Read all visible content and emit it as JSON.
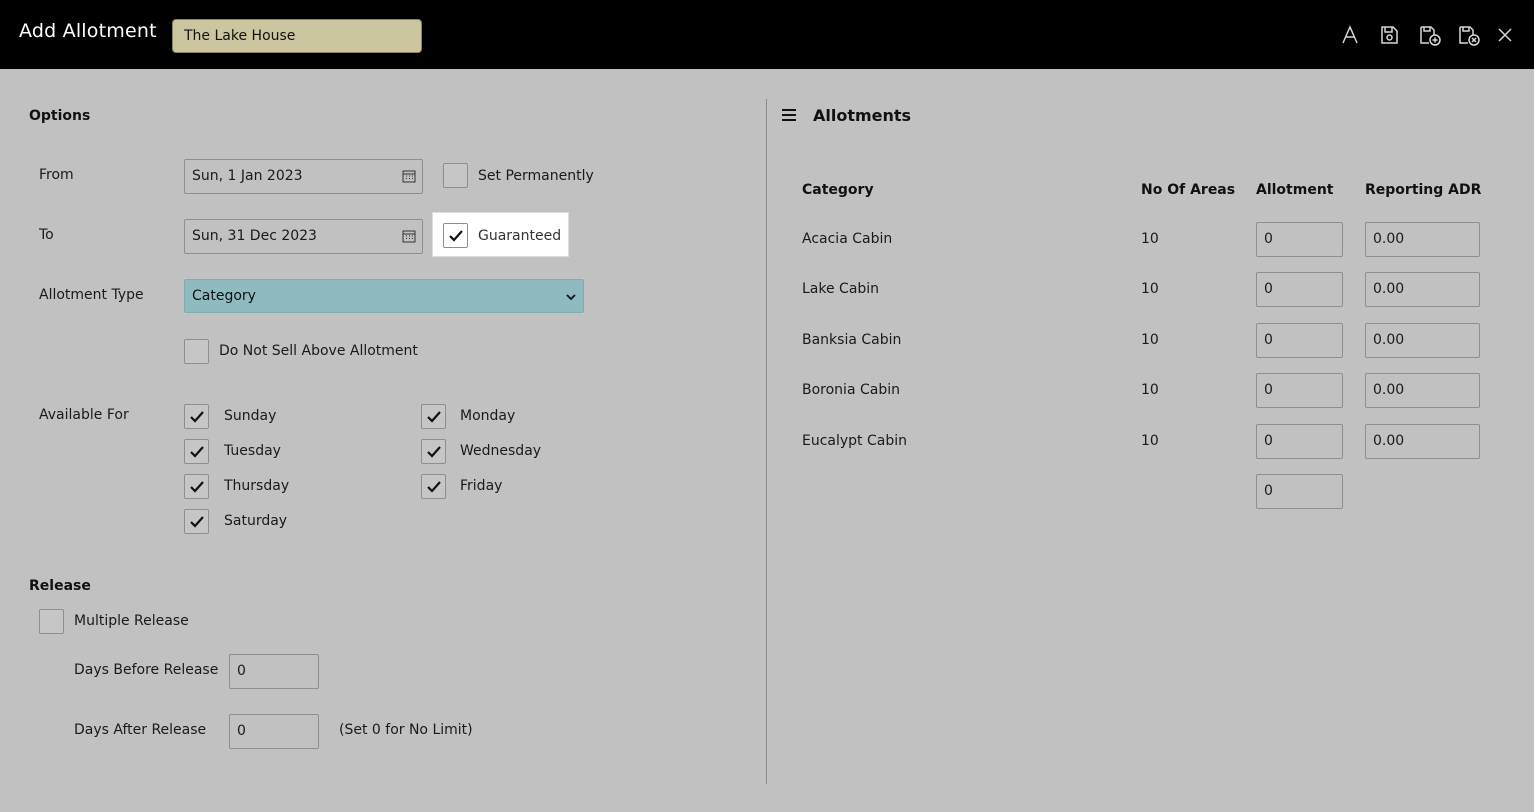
{
  "header": {
    "title": "Add Allotment",
    "property": "The Lake House",
    "icons": [
      "text-icon",
      "save-icon",
      "save-new-icon",
      "save-close-icon",
      "close-icon"
    ]
  },
  "options": {
    "heading": "Options",
    "from_label": "From",
    "from_value": "Sun, 1 Jan 2023",
    "to_label": "To",
    "to_value": "Sun, 31 Dec 2023",
    "set_permanently_label": "Set Permanently",
    "set_permanently_checked": false,
    "guaranteed_label": "Guaranteed",
    "guaranteed_checked": true,
    "allotment_type_label": "Allotment Type",
    "allotment_type_value": "Category",
    "do_not_sell_label": "Do Not Sell Above Allotment",
    "do_not_sell_checked": false,
    "available_for_label": "Available For",
    "days": [
      {
        "label": "Sunday",
        "checked": true
      },
      {
        "label": "Monday",
        "checked": true
      },
      {
        "label": "Tuesday",
        "checked": true
      },
      {
        "label": "Wednesday",
        "checked": true
      },
      {
        "label": "Thursday",
        "checked": true
      },
      {
        "label": "Friday",
        "checked": true
      },
      {
        "label": "Saturday",
        "checked": true
      }
    ]
  },
  "release": {
    "heading": "Release",
    "multiple_release_label": "Multiple Release",
    "multiple_release_checked": false,
    "days_before_label": "Days Before Release",
    "days_before_value": "0",
    "days_after_label": "Days After Release",
    "days_after_value": "0",
    "note": "(Set 0 for No Limit)"
  },
  "allotments": {
    "heading": "Allotments",
    "columns": [
      "Category",
      "No Of Areas",
      "Allotment",
      "Reporting ADR"
    ],
    "rows": [
      {
        "category": "Acacia Cabin",
        "areas": "10",
        "allotment": "0",
        "adr": "0.00"
      },
      {
        "category": "Lake Cabin",
        "areas": "10",
        "allotment": "0",
        "adr": "0.00"
      },
      {
        "category": "Banksia Cabin",
        "areas": "10",
        "allotment": "0",
        "adr": "0.00"
      },
      {
        "category": "Boronia Cabin",
        "areas": "10",
        "allotment": "0",
        "adr": "0.00"
      },
      {
        "category": "Eucalypt Cabin",
        "areas": "10",
        "allotment": "0",
        "adr": "0.00"
      }
    ],
    "total_allotment": "0"
  }
}
